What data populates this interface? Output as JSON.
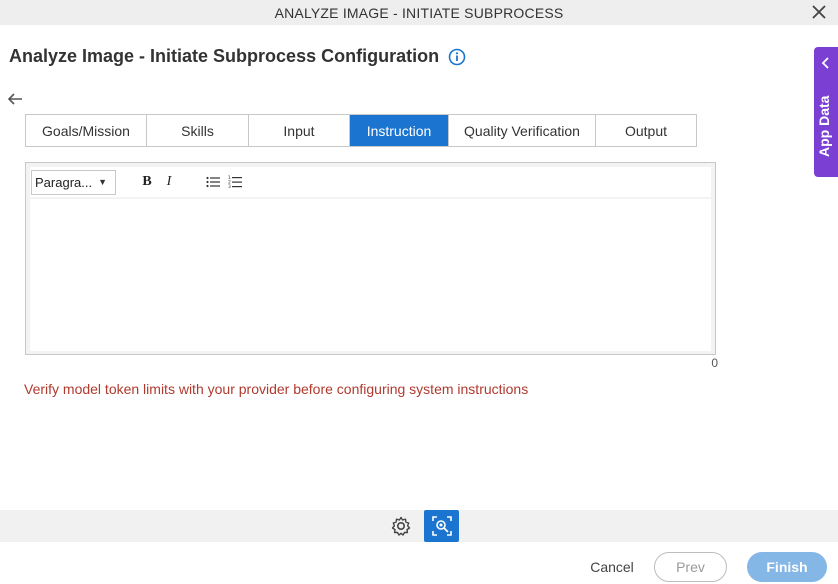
{
  "window": {
    "title": "ANALYZE IMAGE - INITIATE SUBPROCESS"
  },
  "page": {
    "heading": "Analyze Image - Initiate Subprocess Configuration"
  },
  "tabs": [
    {
      "label": "Goals/Mission"
    },
    {
      "label": "Skills"
    },
    {
      "label": "Input"
    },
    {
      "label": "Instruction",
      "active": true
    },
    {
      "label": "Quality Verification"
    },
    {
      "label": "Output"
    }
  ],
  "editor": {
    "format_select": "Paragra...",
    "bold_label": "B",
    "italic_label": "I",
    "content": "",
    "char_count": "0"
  },
  "warning": "Verify model token limits with your provider before configuring system instructions",
  "side_panel": {
    "label": "App Data"
  },
  "footer": {
    "cancel": "Cancel",
    "prev": "Prev",
    "finish": "Finish"
  },
  "colors": {
    "accent": "#1b75d0",
    "side_panel": "#7b3fd4",
    "warning": "#b03a2e",
    "finish_disabled": "#84b6e6"
  },
  "icons": [
    "close-icon",
    "info-icon",
    "back-arrow-icon",
    "bullet-list-icon",
    "numbered-list-icon",
    "chevron-left-icon",
    "gear-icon",
    "image-search-icon"
  ]
}
